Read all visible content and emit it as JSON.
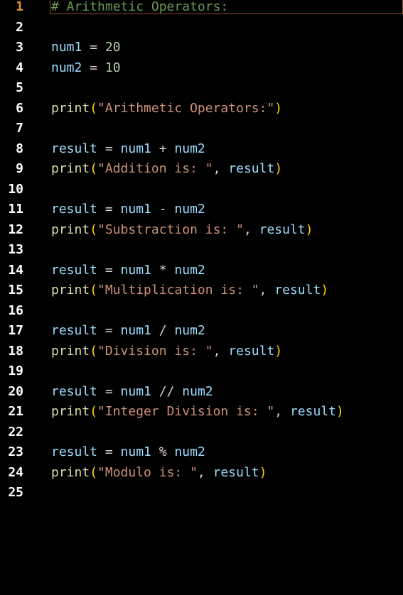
{
  "editor": {
    "active_line": 1,
    "lines": [
      {
        "number": "1",
        "tokens": [
          {
            "t": "# Arithmetic Operators:",
            "k": "comment"
          }
        ]
      },
      {
        "number": "2",
        "tokens": []
      },
      {
        "number": "3",
        "tokens": [
          {
            "t": "num1",
            "k": "var"
          },
          {
            "t": " = ",
            "k": "op"
          },
          {
            "t": "20",
            "k": "num"
          }
        ]
      },
      {
        "number": "4",
        "tokens": [
          {
            "t": "num2",
            "k": "var"
          },
          {
            "t": " = ",
            "k": "op"
          },
          {
            "t": "10",
            "k": "num"
          }
        ]
      },
      {
        "number": "5",
        "tokens": []
      },
      {
        "number": "6",
        "tokens": [
          {
            "t": "print",
            "k": "func"
          },
          {
            "t": "(",
            "k": "paren"
          },
          {
            "t": "\"Arithmetic Operators:\"",
            "k": "str"
          },
          {
            "t": ")",
            "k": "paren"
          }
        ]
      },
      {
        "number": "7",
        "tokens": []
      },
      {
        "number": "8",
        "tokens": [
          {
            "t": "result",
            "k": "var"
          },
          {
            "t": " = ",
            "k": "op"
          },
          {
            "t": "num1",
            "k": "var"
          },
          {
            "t": " + ",
            "k": "op"
          },
          {
            "t": "num2",
            "k": "var"
          }
        ]
      },
      {
        "number": "9",
        "tokens": [
          {
            "t": "print",
            "k": "func"
          },
          {
            "t": "(",
            "k": "paren"
          },
          {
            "t": "\"Addition is: \"",
            "k": "str"
          },
          {
            "t": ", ",
            "k": "punc"
          },
          {
            "t": "result",
            "k": "var"
          },
          {
            "t": ")",
            "k": "paren"
          }
        ]
      },
      {
        "number": "10",
        "tokens": []
      },
      {
        "number": "11",
        "tokens": [
          {
            "t": "result",
            "k": "var"
          },
          {
            "t": " = ",
            "k": "op"
          },
          {
            "t": "num1",
            "k": "var"
          },
          {
            "t": " - ",
            "k": "op"
          },
          {
            "t": "num2",
            "k": "var"
          }
        ]
      },
      {
        "number": "12",
        "tokens": [
          {
            "t": "print",
            "k": "func"
          },
          {
            "t": "(",
            "k": "paren"
          },
          {
            "t": "\"Substraction is: \"",
            "k": "str"
          },
          {
            "t": ", ",
            "k": "punc"
          },
          {
            "t": "result",
            "k": "var"
          },
          {
            "t": ")",
            "k": "paren"
          }
        ]
      },
      {
        "number": "13",
        "tokens": []
      },
      {
        "number": "14",
        "tokens": [
          {
            "t": "result",
            "k": "var"
          },
          {
            "t": " = ",
            "k": "op"
          },
          {
            "t": "num1",
            "k": "var"
          },
          {
            "t": " * ",
            "k": "op"
          },
          {
            "t": "num2",
            "k": "var"
          }
        ]
      },
      {
        "number": "15",
        "tokens": [
          {
            "t": "print",
            "k": "func"
          },
          {
            "t": "(",
            "k": "paren"
          },
          {
            "t": "\"Multiplication is: \"",
            "k": "str"
          },
          {
            "t": ", ",
            "k": "punc"
          },
          {
            "t": "result",
            "k": "var"
          },
          {
            "t": ")",
            "k": "paren"
          }
        ]
      },
      {
        "number": "16",
        "tokens": []
      },
      {
        "number": "17",
        "tokens": [
          {
            "t": "result",
            "k": "var"
          },
          {
            "t": " = ",
            "k": "op"
          },
          {
            "t": "num1",
            "k": "var"
          },
          {
            "t": " / ",
            "k": "op"
          },
          {
            "t": "num2",
            "k": "var"
          }
        ]
      },
      {
        "number": "18",
        "tokens": [
          {
            "t": "print",
            "k": "func"
          },
          {
            "t": "(",
            "k": "paren"
          },
          {
            "t": "\"Division is: \"",
            "k": "str"
          },
          {
            "t": ", ",
            "k": "punc"
          },
          {
            "t": "result",
            "k": "var"
          },
          {
            "t": ")",
            "k": "paren"
          }
        ]
      },
      {
        "number": "19",
        "tokens": []
      },
      {
        "number": "20",
        "tokens": [
          {
            "t": "result",
            "k": "var"
          },
          {
            "t": " = ",
            "k": "op"
          },
          {
            "t": "num1",
            "k": "var"
          },
          {
            "t": " // ",
            "k": "op"
          },
          {
            "t": "num2",
            "k": "var"
          }
        ]
      },
      {
        "number": "21",
        "tokens": [
          {
            "t": "print",
            "k": "func"
          },
          {
            "t": "(",
            "k": "paren"
          },
          {
            "t": "\"Integer Division is: \"",
            "k": "str"
          },
          {
            "t": ", ",
            "k": "punc"
          },
          {
            "t": "result",
            "k": "var"
          },
          {
            "t": ")",
            "k": "paren"
          }
        ]
      },
      {
        "number": "22",
        "tokens": []
      },
      {
        "number": "23",
        "tokens": [
          {
            "t": "result",
            "k": "var"
          },
          {
            "t": " = ",
            "k": "op"
          },
          {
            "t": "num1",
            "k": "var"
          },
          {
            "t": " % ",
            "k": "op"
          },
          {
            "t": "num2",
            "k": "var"
          }
        ]
      },
      {
        "number": "24",
        "tokens": [
          {
            "t": "print",
            "k": "func"
          },
          {
            "t": "(",
            "k": "paren"
          },
          {
            "t": "\"Modulo is: \"",
            "k": "str"
          },
          {
            "t": ", ",
            "k": "punc"
          },
          {
            "t": "result",
            "k": "var"
          },
          {
            "t": ")",
            "k": "paren"
          }
        ]
      },
      {
        "number": "25",
        "tokens": []
      }
    ]
  },
  "colors": {
    "background": "#000000",
    "line_number": "#ffffff",
    "active_line_number": "#e5902e",
    "comment": "#6a9955",
    "variable": "#9cdcfe",
    "number": "#b5cea8",
    "function": "#dcdcaa",
    "paren": "#ffd700",
    "string": "#ce9178",
    "operator": "#d4d4d4"
  }
}
